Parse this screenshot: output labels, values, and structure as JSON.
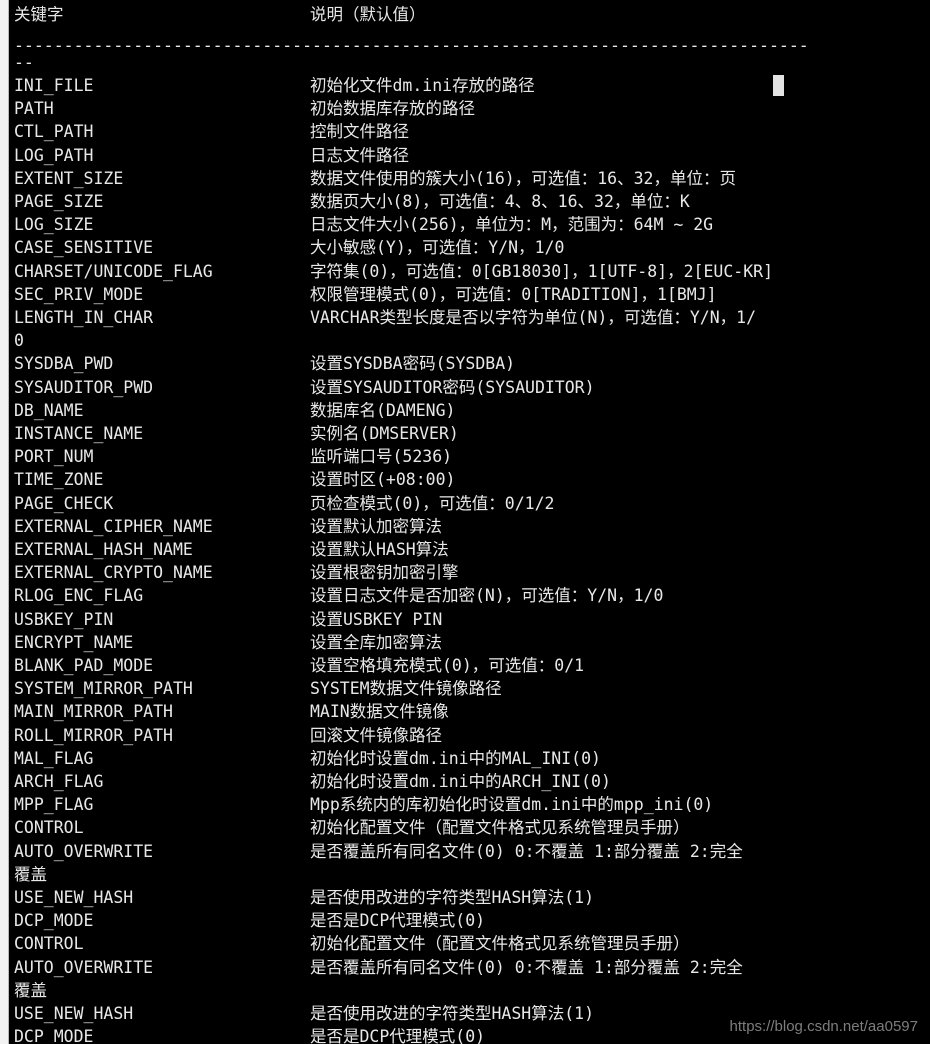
{
  "watermark": {
    "url": "https://blog.csdn.net/aa0597"
  },
  "terminal": {
    "background_color": "#000000",
    "foreground_color": "#e8e8e8",
    "cursor_color": "#e3e3e3",
    "header": {
      "keyword_column": "关键字",
      "description_column": "说明（默认值）"
    },
    "separator": "--------------------------------------------------------------------------------",
    "dash_marker": "--",
    "rows": [
      {
        "key": "INI_FILE",
        "desc": "初始化文件dm.ini存放的路径"
      },
      {
        "key": "PATH",
        "desc": "初始数据库存放的路径"
      },
      {
        "key": "CTL_PATH",
        "desc": "控制文件路径"
      },
      {
        "key": "LOG_PATH",
        "desc": "日志文件路径"
      },
      {
        "key": "EXTENT_SIZE",
        "desc": "数据文件使用的簇大小(16)，可选值：16、32，单位：页"
      },
      {
        "key": "PAGE_SIZE",
        "desc": "数据页大小(8)，可选值：4、8、16、32，单位：K"
      },
      {
        "key": "LOG_SIZE",
        "desc": "日志文件大小(256)，单位为：M，范围为：64M ~ 2G"
      },
      {
        "key": "CASE_SENSITIVE",
        "desc": "大小敏感(Y)，可选值：Y/N，1/0"
      },
      {
        "key": "CHARSET/UNICODE_FLAG",
        "desc": "字符集(0)，可选值：0[GB18030]，1[UTF-8]，2[EUC-KR]"
      },
      {
        "key": "SEC_PRIV_MODE",
        "desc": "权限管理模式(0)，可选值：0[TRADITION]，1[BMJ]"
      },
      {
        "key": "LENGTH_IN_CHAR",
        "desc": "VARCHAR类型长度是否以字符为单位(N)，可选值：Y/N，1/"
      },
      {
        "key": "0",
        "desc": ""
      },
      {
        "key": "SYSDBA_PWD",
        "desc": "设置SYSDBA密码(SYSDBA)"
      },
      {
        "key": "SYSAUDITOR_PWD",
        "desc": "设置SYSAUDITOR密码(SYSAUDITOR)"
      },
      {
        "key": "DB_NAME",
        "desc": "数据库名(DAMENG)"
      },
      {
        "key": "INSTANCE_NAME",
        "desc": "实例名(DMSERVER)"
      },
      {
        "key": "PORT_NUM",
        "desc": "监听端口号(5236)"
      },
      {
        "key": "TIME_ZONE",
        "desc": "设置时区(+08:00)"
      },
      {
        "key": "PAGE_CHECK",
        "desc": "页检查模式(0)，可选值：0/1/2"
      },
      {
        "key": "EXTERNAL_CIPHER_NAME",
        "desc": "设置默认加密算法"
      },
      {
        "key": "EXTERNAL_HASH_NAME",
        "desc": "设置默认HASH算法"
      },
      {
        "key": "EXTERNAL_CRYPTO_NAME",
        "desc": "设置根密钥加密引擎"
      },
      {
        "key": "RLOG_ENC_FLAG",
        "desc": "设置日志文件是否加密(N)，可选值：Y/N，1/0"
      },
      {
        "key": "USBKEY_PIN",
        "desc": "设置USBKEY PIN"
      },
      {
        "key": "ENCRYPT_NAME",
        "desc": "设置全库加密算法"
      },
      {
        "key": "BLANK_PAD_MODE",
        "desc": "设置空格填充模式(0)，可选值：0/1"
      },
      {
        "key": "SYSTEM_MIRROR_PATH",
        "desc": "SYSTEM数据文件镜像路径"
      },
      {
        "key": "MAIN_MIRROR_PATH",
        "desc": "MAIN数据文件镜像"
      },
      {
        "key": "ROLL_MIRROR_PATH",
        "desc": "回滚文件镜像路径"
      },
      {
        "key": "MAL_FLAG",
        "desc": "初始化时设置dm.ini中的MAL_INI(0)"
      },
      {
        "key": "ARCH_FLAG",
        "desc": "初始化时设置dm.ini中的ARCH_INI(0)"
      },
      {
        "key": "MPP_FLAG",
        "desc": "Mpp系统内的库初始化时设置dm.ini中的mpp_ini(0)"
      },
      {
        "key": "CONTROL",
        "desc": "初始化配置文件（配置文件格式见系统管理员手册）"
      },
      {
        "key": "AUTO_OVERWRITE",
        "desc": "是否覆盖所有同名文件(0) 0:不覆盖 1:部分覆盖 2:完全"
      },
      {
        "key": "覆盖",
        "desc": ""
      },
      {
        "key": "USE_NEW_HASH",
        "desc": "是否使用改进的字符类型HASH算法(1)"
      },
      {
        "key": "DCP_MODE",
        "desc": "是否是DCP代理模式(0)"
      },
      {
        "key": "CONTROL",
        "desc": "初始化配置文件（配置文件格式见系统管理员手册）"
      },
      {
        "key": "AUTO_OVERWRITE",
        "desc": "是否覆盖所有同名文件(0) 0:不覆盖 1:部分覆盖 2:完全"
      },
      {
        "key": "覆盖",
        "desc": ""
      },
      {
        "key": "USE_NEW_HASH",
        "desc": "是否使用改进的字符类型HASH算法(1)"
      },
      {
        "key": "DCP_MODE",
        "desc": "是否是DCP代理模式(0)"
      }
    ]
  }
}
